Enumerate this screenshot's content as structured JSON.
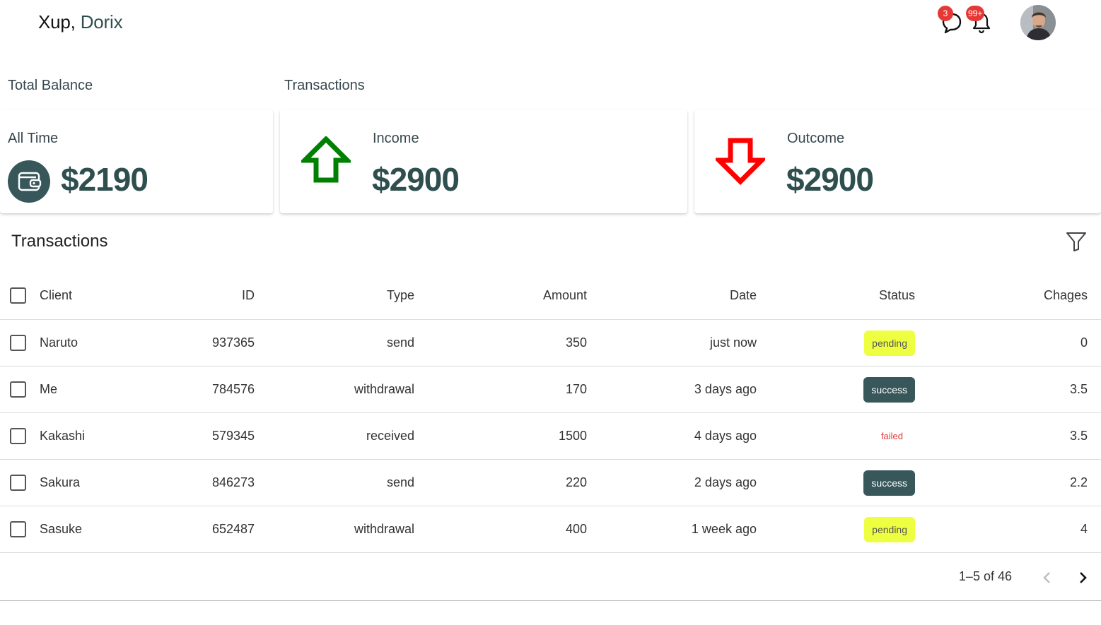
{
  "header": {
    "greeting": "Xup,",
    "user_name": "Dorix",
    "chat_badge": "3",
    "notification_badge": "99+",
    "icons": [
      "chat-icon",
      "bell-icon",
      "avatar"
    ]
  },
  "summary": {
    "balance_section_label": "Total Balance",
    "transactions_section_label": "Transactions",
    "balance": {
      "label": "All Time",
      "value": "$2190",
      "icon": "wallet-icon"
    },
    "income": {
      "label": "Income",
      "value": "$2900",
      "icon": "arrow-up-icon",
      "color": "#008000"
    },
    "outcome": {
      "label": "Outcome",
      "value": "$2900",
      "icon": "arrow-down-icon",
      "color": "#ff0000"
    }
  },
  "table": {
    "title": "Transactions",
    "columns": [
      "Client",
      "ID",
      "Type",
      "Amount",
      "Date",
      "Status",
      "Chages"
    ],
    "rows": [
      {
        "client": "Naruto",
        "id": "937365",
        "type": "send",
        "amount": "350",
        "date": "just now",
        "status": "pending",
        "changes": "0"
      },
      {
        "client": "Me",
        "id": "784576",
        "type": "withdrawal",
        "amount": "170",
        "date": "3 days ago",
        "status": "success",
        "changes": "3.5"
      },
      {
        "client": "Kakashi",
        "id": "579345",
        "type": "received",
        "amount": "1500",
        "date": "4 days ago",
        "status": "failed",
        "changes": "3.5"
      },
      {
        "client": "Sakura",
        "id": "846273",
        "type": "send",
        "amount": "220",
        "date": "2 days ago",
        "status": "success",
        "changes": "2.2"
      },
      {
        "client": "Sasuke",
        "id": "652487",
        "type": "withdrawal",
        "amount": "400",
        "date": "1 week ago",
        "status": "pending",
        "changes": "4"
      }
    ],
    "pagination": {
      "range": "1–5 of 46"
    }
  },
  "colors": {
    "accent": "#37575a",
    "pending": "#eeff41",
    "failed": "#e53935",
    "badge": "#e53935"
  }
}
